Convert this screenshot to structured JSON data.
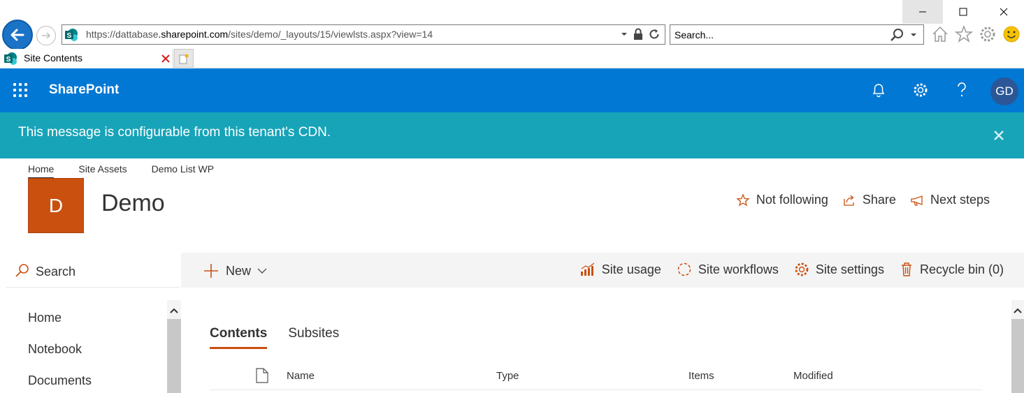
{
  "browser": {
    "url_prefix": "https://dattabase",
    "url_domain": ".sharepoint.com",
    "url_path": "/sites/demo/_layouts/15/viewlsts.aspx?view=14",
    "search_placeholder": "Search...",
    "tab_title": "Site Contents"
  },
  "suite_bar": {
    "brand": "SharePoint",
    "avatar_initials": "GD",
    "color": "#0078d4"
  },
  "message_bar": {
    "text": "This message is configurable from this tenant's CDN.",
    "color": "#17a3b8"
  },
  "site": {
    "top_nav": [
      "Home",
      "Site Assets",
      "Demo List WP"
    ],
    "logo_letter": "D",
    "logo_color": "#ca5010",
    "title": "Demo",
    "actions": {
      "follow": "Not following",
      "share": "Share",
      "next_steps": "Next steps"
    }
  },
  "left_nav": {
    "search_label": "Search",
    "items": [
      "Home",
      "Notebook",
      "Documents"
    ]
  },
  "command_bar": {
    "new_label": "New",
    "site_usage": "Site usage",
    "site_workflows": "Site workflows",
    "site_settings": "Site settings",
    "recycle_bin": "Recycle bin (0)"
  },
  "content": {
    "tabs": [
      "Contents",
      "Subsites"
    ],
    "columns": [
      "Name",
      "Type",
      "Items",
      "Modified"
    ]
  }
}
